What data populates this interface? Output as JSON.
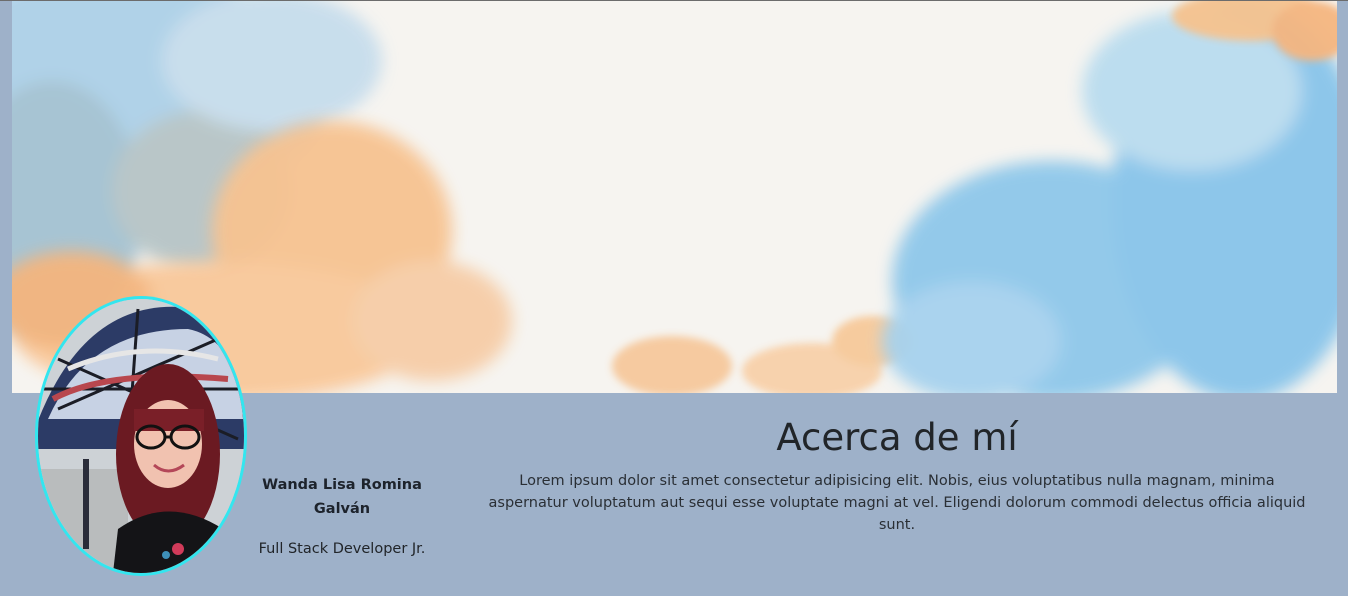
{
  "profile": {
    "name": "Wanda Lisa Romina Galván",
    "role": "Full Stack Developer Jr."
  },
  "about": {
    "title": "Acerca de mí",
    "text": "Lorem ipsum dolor sit amet consectetur adipisicing elit. Nobis, eius voluptatibus nulla magnam, minima aspernatur voluptatum aut sequi esse voluptate magni at vel. Eligendi dolorum commodi delectus officia aliquid sunt."
  },
  "colors": {
    "page_background": "#9eb1c9",
    "avatar_ring": "#33e6ef",
    "watercolor_blue": "#7fbfe6",
    "watercolor_orange": "#f8c08a"
  }
}
